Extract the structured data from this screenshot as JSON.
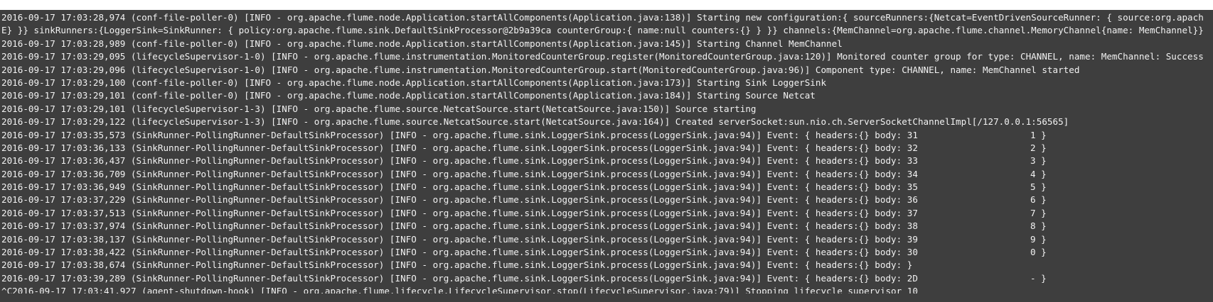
{
  "terminal": {
    "lines": [
      {
        "text": "2016-09-17 17:03:28,974 (conf-file-poller-0) [INFO - org.apache.flume.node.Application.startAllComponents(Application.java:138)] Starting new configuration:{ sourceRunners:{Netcat=EventDrivenSourceRunner: { source:org.apach",
        "tail": ""
      },
      {
        "text": "E} }} sinkRunners:{LoggerSink=SinkRunner: { policy:org.apache.flume.sink.DefaultSinkProcessor@2b9a39ca counterGroup:{ name:null counters:{} } }} channels:{MemChannel=org.apache.flume.channel.MemoryChannel{name: MemChannel}}",
        "tail": ""
      },
      {
        "text": "2016-09-17 17:03:28,989 (conf-file-poller-0) [INFO - org.apache.flume.node.Application.startAllComponents(Application.java:145)] Starting Channel MemChannel",
        "tail": ""
      },
      {
        "text": "2016-09-17 17:03:29,095 (lifecycleSupervisor-1-0) [INFO - org.apache.flume.instrumentation.MonitoredCounterGroup.register(MonitoredCounterGroup.java:120)] Monitored counter group for type: CHANNEL, name: MemChannel: Success",
        "tail": ""
      },
      {
        "text": "2016-09-17 17:03:29,096 (lifecycleSupervisor-1-0) [INFO - org.apache.flume.instrumentation.MonitoredCounterGroup.start(MonitoredCounterGroup.java:96)] Component type: CHANNEL, name: MemChannel started",
        "tail": ""
      },
      {
        "text": "2016-09-17 17:03:29,100 (conf-file-poller-0) [INFO - org.apache.flume.node.Application.startAllComponents(Application.java:173)] Starting Sink LoggerSink",
        "tail": ""
      },
      {
        "text": "2016-09-17 17:03:29,101 (conf-file-poller-0) [INFO - org.apache.flume.node.Application.startAllComponents(Application.java:184)] Starting Source Netcat",
        "tail": ""
      },
      {
        "text": "2016-09-17 17:03:29,101 (lifecycleSupervisor-1-3) [INFO - org.apache.flume.source.NetcatSource.start(NetcatSource.java:150)] Source starting",
        "tail": ""
      },
      {
        "text": "2016-09-17 17:03:29,122 (lifecycleSupervisor-1-3) [INFO - org.apache.flume.source.NetcatSource.start(NetcatSource.java:164)] Created serverSocket:sun.nio.ch.ServerSocketChannelImpl[/127.0.0.1:56565]",
        "tail": ""
      },
      {
        "text": "2016-09-17 17:03:35,573 (SinkRunner-PollingRunner-DefaultSinkProcessor) [INFO - org.apache.flume.sink.LoggerSink.process(LoggerSink.java:94)] Event: { headers:{} body: 31",
        "tail": "1 }"
      },
      {
        "text": "2016-09-17 17:03:36,133 (SinkRunner-PollingRunner-DefaultSinkProcessor) [INFO - org.apache.flume.sink.LoggerSink.process(LoggerSink.java:94)] Event: { headers:{} body: 32",
        "tail": "2 }"
      },
      {
        "text": "2016-09-17 17:03:36,437 (SinkRunner-PollingRunner-DefaultSinkProcessor) [INFO - org.apache.flume.sink.LoggerSink.process(LoggerSink.java:94)] Event: { headers:{} body: 33",
        "tail": "3 }"
      },
      {
        "text": "2016-09-17 17:03:36,709 (SinkRunner-PollingRunner-DefaultSinkProcessor) [INFO - org.apache.flume.sink.LoggerSink.process(LoggerSink.java:94)] Event: { headers:{} body: 34",
        "tail": "4 }"
      },
      {
        "text": "2016-09-17 17:03:36,949 (SinkRunner-PollingRunner-DefaultSinkProcessor) [INFO - org.apache.flume.sink.LoggerSink.process(LoggerSink.java:94)] Event: { headers:{} body: 35",
        "tail": "5 }"
      },
      {
        "text": "2016-09-17 17:03:37,229 (SinkRunner-PollingRunner-DefaultSinkProcessor) [INFO - org.apache.flume.sink.LoggerSink.process(LoggerSink.java:94)] Event: { headers:{} body: 36",
        "tail": "6 }"
      },
      {
        "text": "2016-09-17 17:03:37,513 (SinkRunner-PollingRunner-DefaultSinkProcessor) [INFO - org.apache.flume.sink.LoggerSink.process(LoggerSink.java:94)] Event: { headers:{} body: 37",
        "tail": "7 }"
      },
      {
        "text": "2016-09-17 17:03:37,974 (SinkRunner-PollingRunner-DefaultSinkProcessor) [INFO - org.apache.flume.sink.LoggerSink.process(LoggerSink.java:94)] Event: { headers:{} body: 38",
        "tail": "8 }"
      },
      {
        "text": "2016-09-17 17:03:38,137 (SinkRunner-PollingRunner-DefaultSinkProcessor) [INFO - org.apache.flume.sink.LoggerSink.process(LoggerSink.java:94)] Event: { headers:{} body: 39",
        "tail": "9 }"
      },
      {
        "text": "2016-09-17 17:03:38,422 (SinkRunner-PollingRunner-DefaultSinkProcessor) [INFO - org.apache.flume.sink.LoggerSink.process(LoggerSink.java:94)] Event: { headers:{} body: 30",
        "tail": "0 }"
      },
      {
        "text": "2016-09-17 17:03:38,674 (SinkRunner-PollingRunner-DefaultSinkProcessor) [INFO - org.apache.flume.sink.LoggerSink.process(LoggerSink.java:94)] Event: { headers:{} body: }",
        "tail": ""
      },
      {
        "text": "2016-09-17 17:03:39,289 (SinkRunner-PollingRunner-DefaultSinkProcessor) [INFO - org.apache.flume.sink.LoggerSink.process(LoggerSink.java:94)] Event: { headers:{} body: 2D",
        "tail": "- }"
      },
      {
        "text": "^C2016-09-17 17:03:41,927 (agent-shutdown-hook) [INFO - org.apache.flume.lifecycle.LifecycleSupervisor.stop(LifecycleSupervisor.java:79)] Stopping lifecycle supervisor 10",
        "tail": ""
      }
    ]
  },
  "colors": {
    "terminal_bg": "#3e3e3e",
    "terminal_fg": "#f2f2f2",
    "page_bg": "#ffffff"
  }
}
